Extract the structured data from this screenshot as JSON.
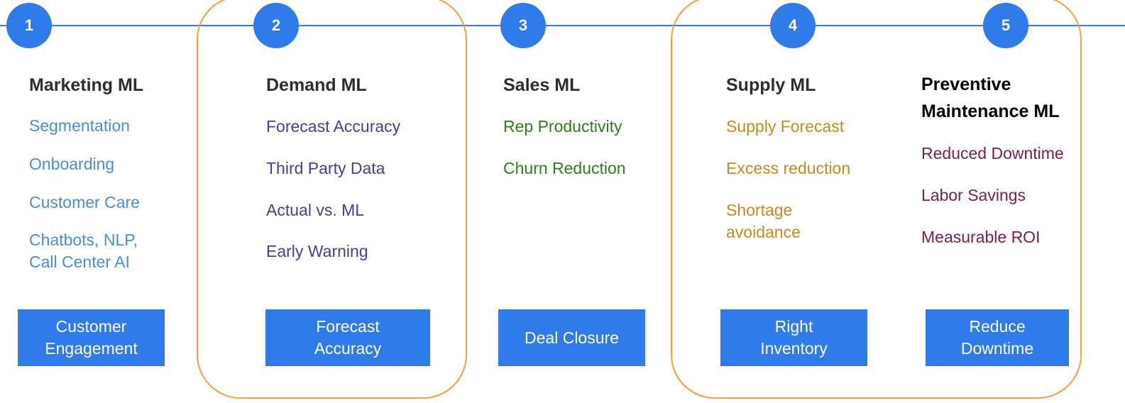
{
  "colors": {
    "line": "#3b7be6",
    "accent": "#2f7bea",
    "highlight_outline": "#f5a042"
  },
  "stages": [
    {
      "number": "1",
      "title": "Marketing ML",
      "text_color": "#4a8fd0",
      "items": [
        "Segmentation",
        "Onboarding",
        "Customer Care",
        "Chatbots, NLP,\nCall Center AI"
      ],
      "outcome": "Customer\nEngagement"
    },
    {
      "number": "2",
      "title": "Demand ML",
      "text_color": "#4b3b9a",
      "items": [
        "Forecast Accuracy",
        "Third Party Data",
        "Actual vs. ML",
        "Early Warning"
      ],
      "outcome": "Forecast\nAccuracy"
    },
    {
      "number": "3",
      "title": "Sales ML",
      "text_color": "#2e7d1e",
      "items": [
        "Rep Productivity",
        "Churn Reduction"
      ],
      "outcome": "Deal Closure"
    },
    {
      "number": "4",
      "title": "Supply ML",
      "text_color": "#c48b1f",
      "items": [
        "Supply Forecast",
        "Excess reduction",
        "Shortage\navoidance"
      ],
      "outcome": "Right\nInventory"
    },
    {
      "number": "5",
      "title": "Preventive\nMaintenance ML",
      "text_color": "#7a1f4a",
      "items": [
        "Reduced Downtime",
        "Labor Savings",
        "Measurable ROI"
      ],
      "outcome": "Reduce\nDowntime"
    }
  ]
}
